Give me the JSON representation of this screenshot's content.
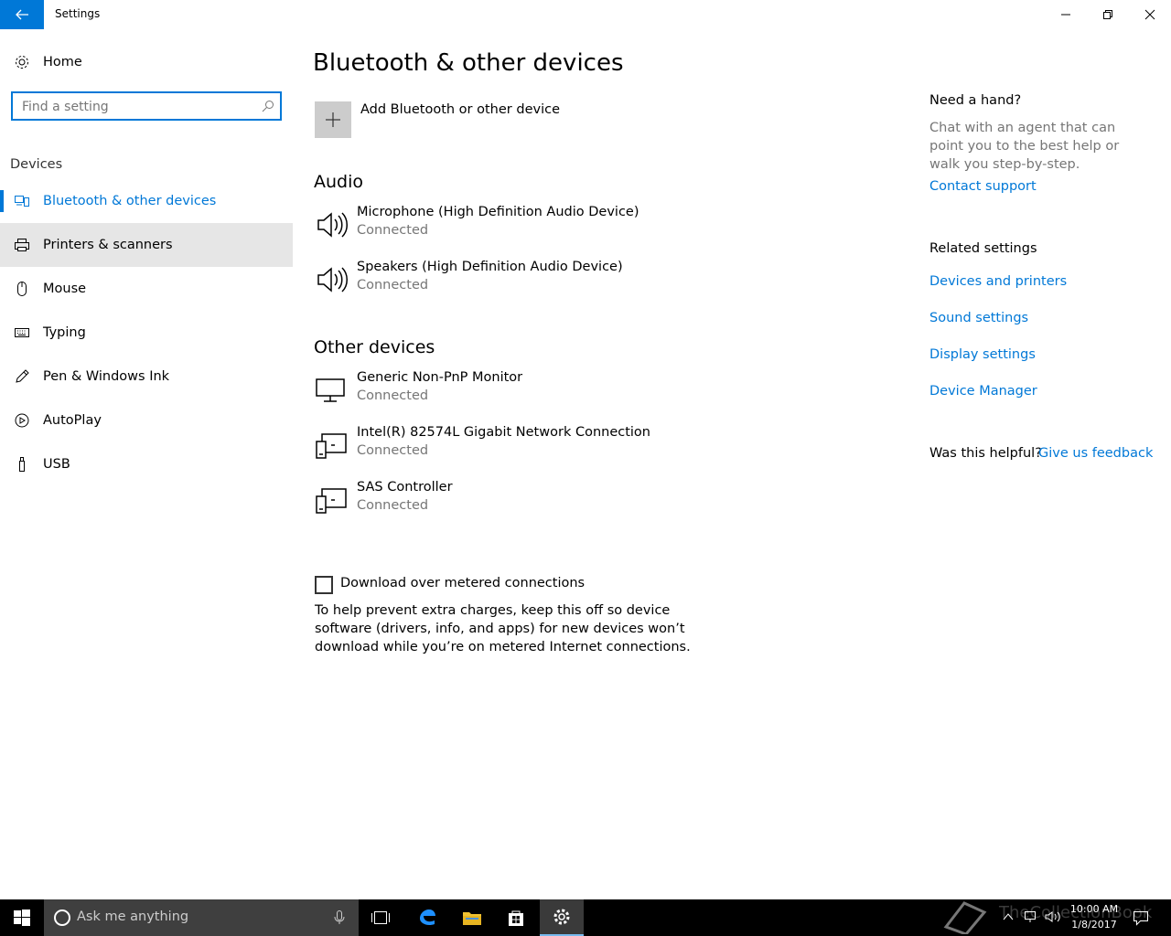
{
  "window": {
    "title": "Settings"
  },
  "sidebar": {
    "home_label": "Home",
    "search_placeholder": "Find a setting",
    "section_label": "Devices",
    "items": [
      {
        "label": "Bluetooth & other devices",
        "icon": "bluetooth-devices-icon",
        "selected": true
      },
      {
        "label": "Printers & scanners",
        "icon": "printer-icon",
        "hover": true
      },
      {
        "label": "Mouse",
        "icon": "mouse-icon"
      },
      {
        "label": "Typing",
        "icon": "keyboard-icon"
      },
      {
        "label": "Pen & Windows Ink",
        "icon": "pen-icon"
      },
      {
        "label": "AutoPlay",
        "icon": "autoplay-icon"
      },
      {
        "label": "USB",
        "icon": "usb-icon"
      }
    ]
  },
  "main": {
    "title": "Bluetooth & other devices",
    "add_label": "Add Bluetooth or other device",
    "audio_title": "Audio",
    "audio_devices": [
      {
        "name": "Microphone (High Definition Audio Device)",
        "status": "Connected",
        "icon": "speaker-icon"
      },
      {
        "name": "Speakers (High Definition Audio Device)",
        "status": "Connected",
        "icon": "speaker-icon"
      }
    ],
    "other_title": "Other devices",
    "other_devices": [
      {
        "name": "Generic Non-PnP Monitor",
        "status": "Connected",
        "icon": "monitor-icon"
      },
      {
        "name": "Intel(R) 82574L Gigabit Network Connection",
        "status": "Connected",
        "icon": "device-icon"
      },
      {
        "name": "SAS Controller",
        "status": "Connected",
        "icon": "device-icon"
      }
    ],
    "metered_label": "Download over metered connections",
    "metered_checked": false,
    "metered_desc": "To help prevent extra charges, keep this off so device software (drivers, info, and apps) for new devices won’t download while you’re on metered Internet connections."
  },
  "right_panel": {
    "help_heading": "Need a hand?",
    "help_text": "Chat with an agent that can point you to the best help or walk you step-by-step.",
    "contact_link": "Contact support",
    "related_heading": "Related settings",
    "related_links": [
      "Devices and printers",
      "Sound settings",
      "Display settings",
      "Device Manager"
    ],
    "helpful_label": "Was this helpful?",
    "feedback_link": "Give us feedback"
  },
  "taskbar": {
    "search_text": "Ask me anything",
    "time": "10:00 AM",
    "date": "1/8/2017",
    "watermark": "TheCollectionBook"
  },
  "colors": {
    "accent": "#0078d7",
    "hover_bg": "#e6e6e6",
    "secondary_text": "#767676",
    "taskbar": "#000000"
  }
}
